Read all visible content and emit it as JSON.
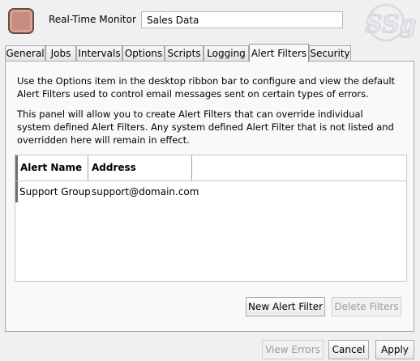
{
  "header": {
    "app_label": "Real-Time Monitor",
    "name_value": "Sales Data",
    "icon": "app-icon",
    "logo_text": "SSg"
  },
  "tabs": [
    {
      "label": "General"
    },
    {
      "label": "Jobs"
    },
    {
      "label": "Intervals"
    },
    {
      "label": "Options"
    },
    {
      "label": "Scripts"
    },
    {
      "label": "Logging"
    },
    {
      "label": "Alert Filters",
      "active": true
    },
    {
      "label": "Security"
    }
  ],
  "panel": {
    "paragraph1": "Use the Options item in the desktop ribbon bar to configure and view the default Alert Filters used to control email messages sent on certain types of errors.",
    "paragraph2": "This panel will allow you to create Alert Filters that can override individual system defined Alert Filters. Any system defined Alert Filter that is not listed and overridden here will remain in effect.",
    "columns": {
      "name": "Alert Name",
      "address": "Address"
    },
    "rows": [
      {
        "name": "Support Group",
        "address": "support@domain.com"
      }
    ],
    "new_filter_label": "New Alert Filter",
    "delete_filters_label": "Delete Filters"
  },
  "footer": {
    "view_errors_label": "View Errors",
    "cancel_label": "Cancel",
    "apply_label": "Apply"
  }
}
